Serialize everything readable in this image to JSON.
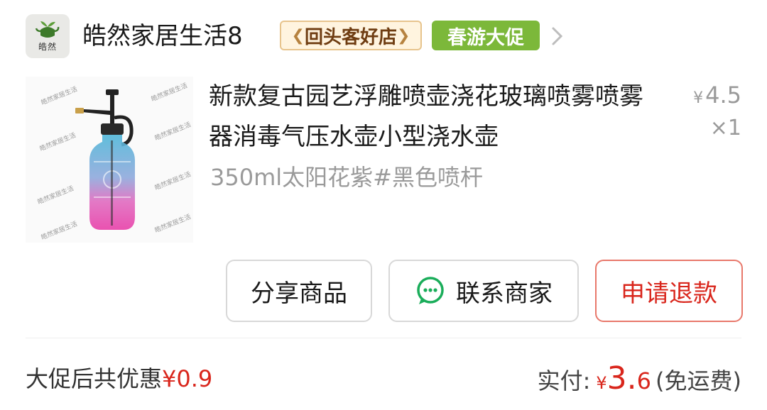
{
  "shop": {
    "logo_text": "皓然",
    "name": "皓然家居生活8",
    "badge_returning": "回头客好店",
    "badge_promo": "春游大促"
  },
  "product": {
    "watermark": "皓然家居生活",
    "title": "新款复古园艺浮雕喷壶浇花玻璃喷雾喷雾器消毒气压水壶小型浇水壶",
    "spec": "350ml太阳花紫#黑色喷杆",
    "currency": "¥",
    "unit_price": "4.5",
    "quantity": "×1"
  },
  "actions": {
    "share": "分享商品",
    "contact": "联系商家",
    "refund": "申请退款"
  },
  "summary": {
    "discount_label": "大促后共优惠",
    "discount_amount": "¥0.9",
    "paid_label": "实付:",
    "paid_currency": "¥",
    "paid_int": "3.",
    "paid_dec": "6",
    "paid_note": "(免运费)"
  },
  "colors": {
    "accent_red": "#d9261c",
    "promo_green": "#7cb83a",
    "badge_gold": "#fff4df"
  }
}
